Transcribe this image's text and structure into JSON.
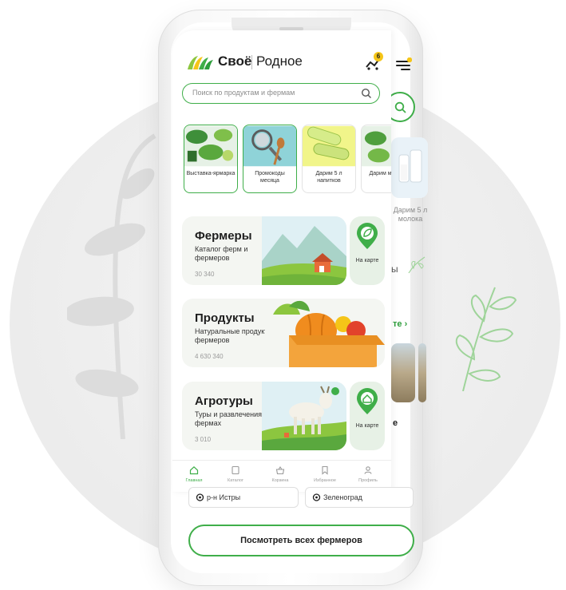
{
  "brand": {
    "name_bold": "Своё",
    "name_light": "Родное"
  },
  "header": {
    "cart_count": "6"
  },
  "search": {
    "placeholder": "Поиск по продуктам и фермам"
  },
  "categories": [
    {
      "label": "Выставка-ярмарка"
    },
    {
      "label": "Промокоды месяца"
    },
    {
      "label": "Дарим 5 л напитков"
    },
    {
      "label": "Дарим молока"
    }
  ],
  "cards": [
    {
      "title": "Фермеры",
      "subtitle": "Каталог ферм и фермеров",
      "count": "30 340"
    },
    {
      "title": "Продукты",
      "subtitle": "Натуральные продукты от фермеров",
      "count": "4 630 340"
    },
    {
      "title": "Агротуры",
      "subtitle": "Туры и развлечения на фермах",
      "count": "3 010"
    }
  ],
  "map_buttons": [
    {
      "label": "На карте"
    },
    {
      "label": "На карте"
    }
  ],
  "tabbar": [
    {
      "label": "Главная",
      "icon": "home-icon",
      "active": true
    },
    {
      "label": "Каталог",
      "icon": "catalog-icon",
      "active": false
    },
    {
      "label": "Корзина",
      "icon": "basket-icon",
      "active": false
    },
    {
      "label": "Избранное",
      "icon": "bookmark-icon",
      "active": false
    },
    {
      "label": "Профиль",
      "icon": "profile-icon",
      "active": false
    }
  ],
  "behind": {
    "tile_label": "Дарим 5 л молока",
    "section_tail": "ы",
    "link_tail": "те",
    "card_tail": "е"
  },
  "locations": [
    {
      "label": "р-н Истры"
    },
    {
      "label": "Зеленоград"
    }
  ],
  "cta": {
    "label": "Посмотреть всех фермеров"
  },
  "colors": {
    "accent": "#3fae49",
    "badge": "#f5c518",
    "card_bg": "#f4f6f2"
  }
}
